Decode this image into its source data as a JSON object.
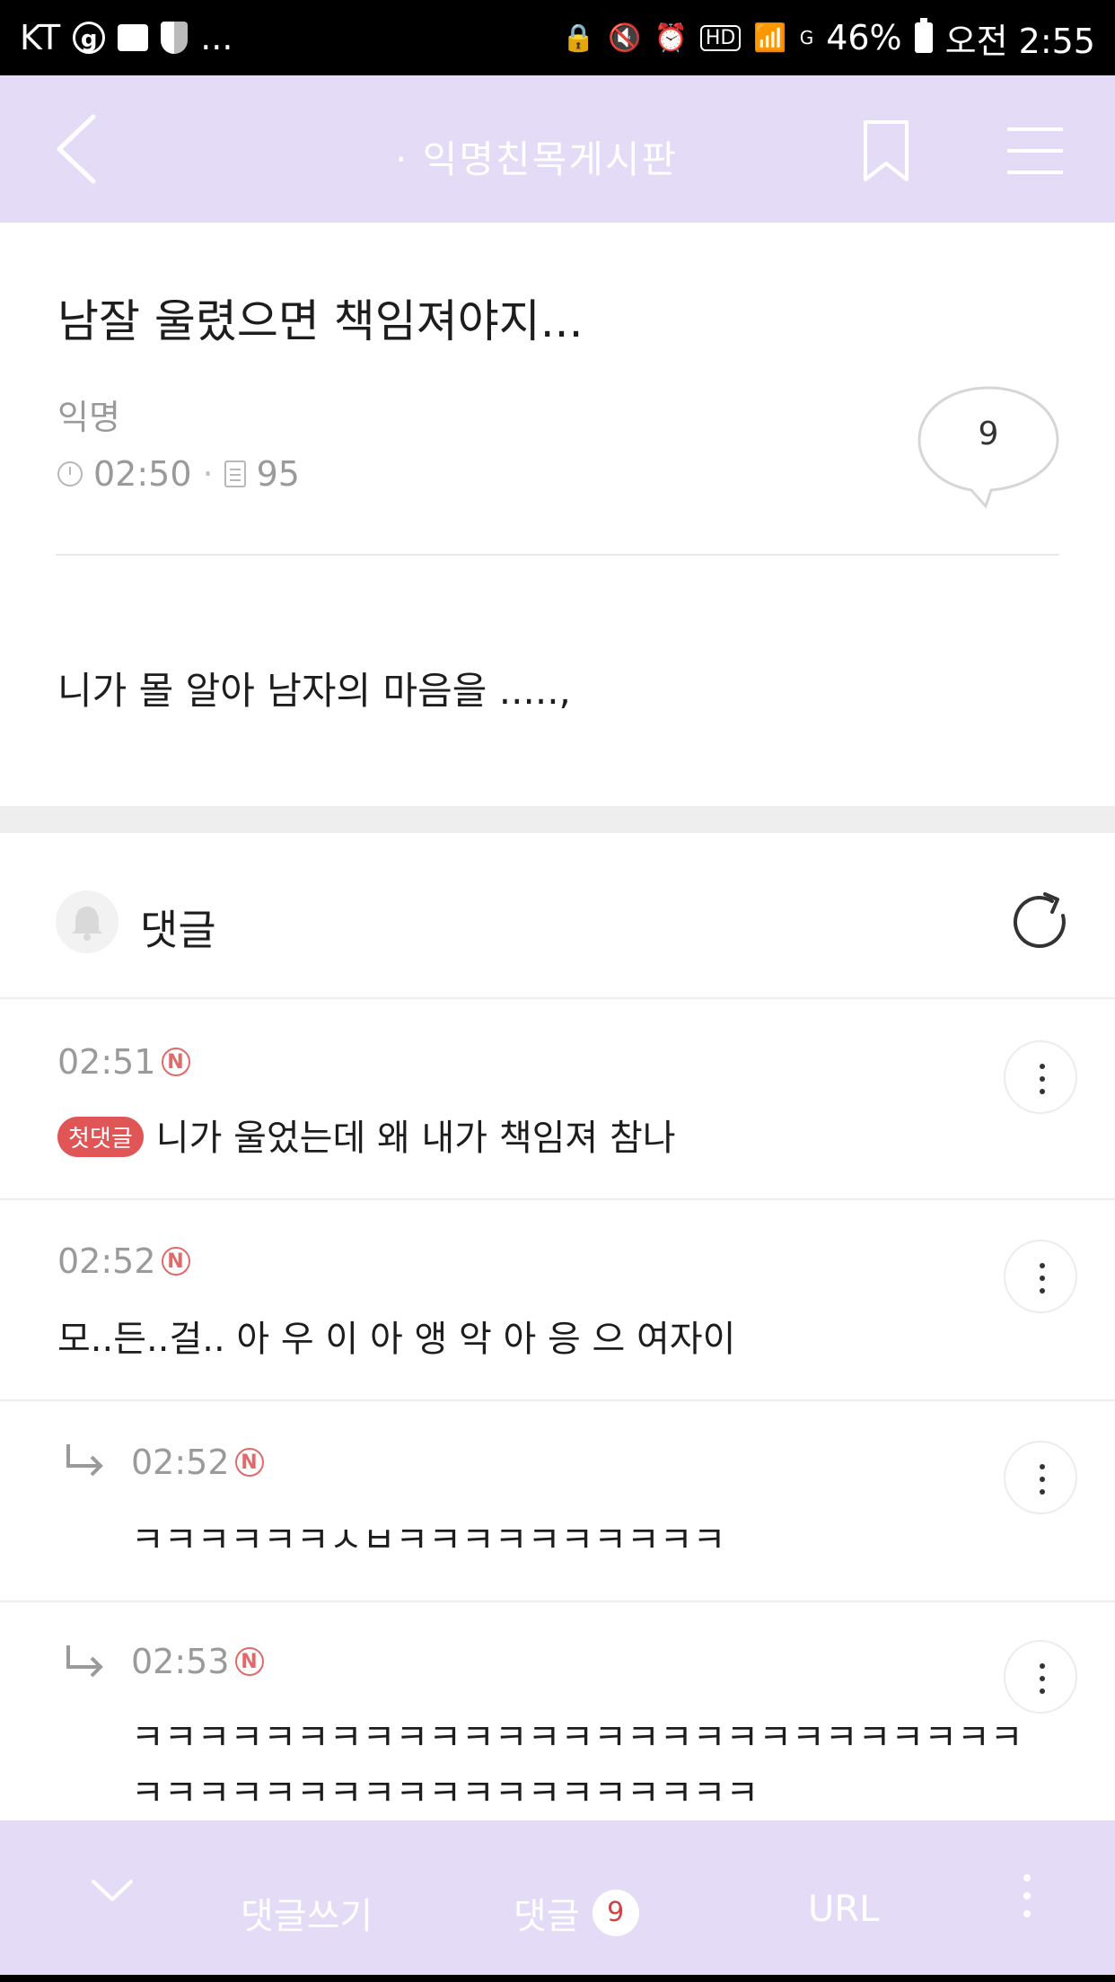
{
  "status_bar": {
    "carrier": "KT",
    "g_icon": "g",
    "battery": "46%",
    "time": "오전 2:55",
    "signal": "G",
    "ellipsis": "...",
    "hd": "HD"
  },
  "top_bar": {
    "title": "· 익명친목게시판"
  },
  "post": {
    "title": "남잘 울렸으면 책임져야지...",
    "author": "익명",
    "time": "02:50",
    "views": "95",
    "comment_count": "9",
    "body": "니가 몰 알아 남자의 마음을 .....,",
    "separator": "·"
  },
  "comments_section": {
    "label": "댓글",
    "items": [
      {
        "time": "02:51",
        "badge": "N",
        "first_label": "첫댓글",
        "text": "니가 울었는데 왜 내가 책임져 참나"
      },
      {
        "time": "02:52",
        "badge": "N",
        "text": "모..든..걸.. 아 우 이 아 앵 악 아 응 으 여자이"
      },
      {
        "time": "02:52",
        "badge": "N",
        "text": "ㅋㅋㅋㅋㅋㅋㅅㅂㅋㅋㅋㅋㅋㅋㅋㅋㅋㅋ"
      },
      {
        "time": "02:53",
        "badge": "N",
        "text_line1": "ㅋㅋㅋㅋㅋㅋㅋㅋㅋㅋㅋㅋㅋㅋㅋㅋㅋㅋㅋㅋㅋㅋㅋㅋㅋㅋㅋ",
        "text_line2": "ㅋㅋㅋㅋㅋㅋㅋㅋㅋㅋㅋㅋㅋㅋㅋㅋㅋㅋㅋ"
      }
    ]
  },
  "bottom_bar": {
    "write_label": "댓글쓰기",
    "comments_label": "댓글",
    "comments_count": "9",
    "url_label": "URL"
  },
  "icons": {
    "back": "chevron-left-icon",
    "bookmark": "bookmark-icon",
    "menu": "hamburger-menu-icon",
    "refresh": "refresh-icon",
    "bell": "bell-icon",
    "more": "more-vertical-icon",
    "reply": "reply-arrow-icon",
    "down": "chevron-down-icon"
  },
  "colors": {
    "accent": "#e4dbf7",
    "new_badge": "#e06a6a",
    "first_badge": "#e05656"
  }
}
